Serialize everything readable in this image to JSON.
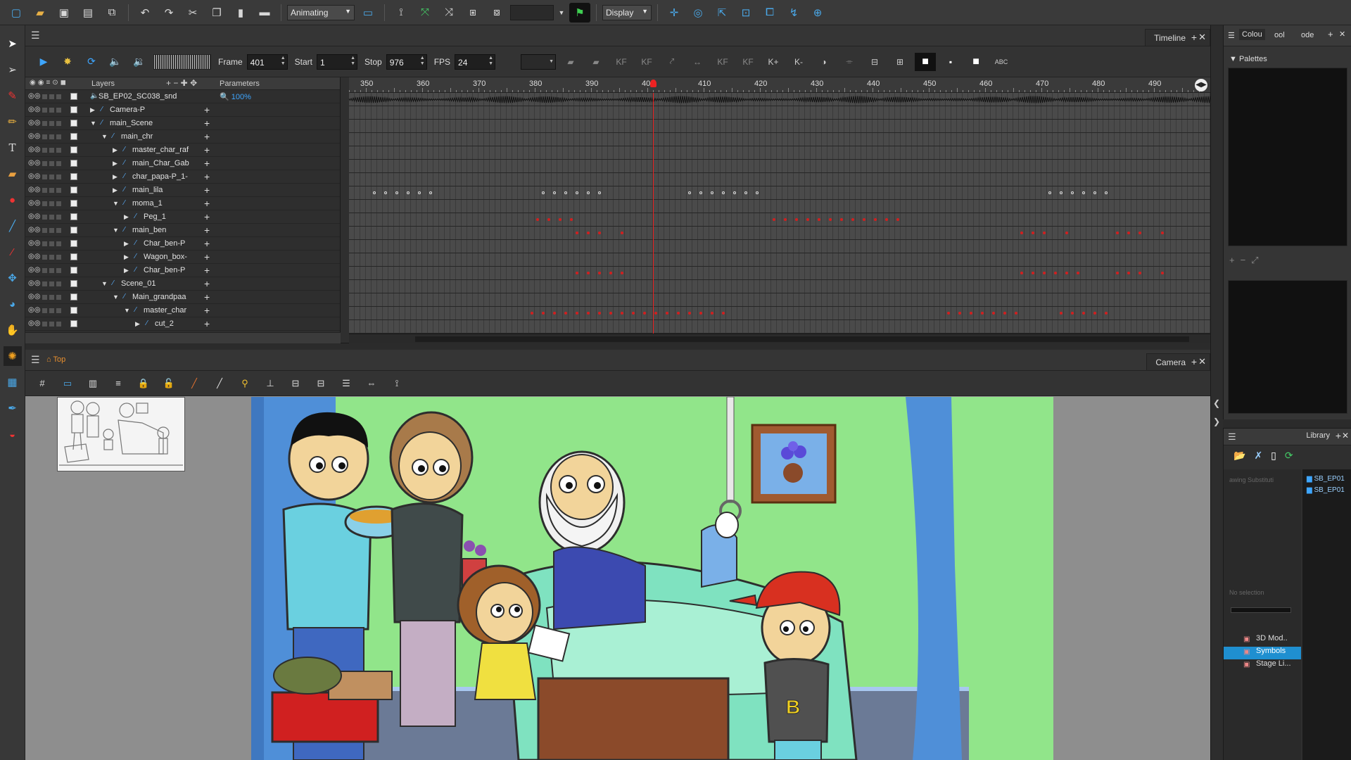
{
  "toolbar": {
    "mode_select": "Animating",
    "display_select": "Display",
    "blank_select": ""
  },
  "timeline": {
    "tab_label": "Timeline",
    "frame_label": "Frame",
    "frame_value": "401",
    "start_label": "Start",
    "start_value": "1",
    "stop_label": "Stop",
    "stop_value": "976",
    "fps_label": "FPS",
    "fps_value": "24",
    "layers_header": "Layers",
    "params_header": "Parameters",
    "ruler_ticks": [
      "350",
      "360",
      "370",
      "380",
      "390",
      "400",
      "410",
      "420",
      "430",
      "440",
      "450",
      "460",
      "470",
      "480",
      "490"
    ],
    "current_frame": 401,
    "layers": [
      {
        "name": "SB_EP02_SC038_snd",
        "indent": 0,
        "type": "sound",
        "expander": "",
        "param": "100%"
      },
      {
        "name": "Camera-P",
        "indent": 1,
        "type": "peg",
        "expander": "closed",
        "param": ""
      },
      {
        "name": "main_Scene",
        "indent": 1,
        "type": "peg",
        "expander": "open",
        "param": ""
      },
      {
        "name": "main_chr",
        "indent": 2,
        "type": "peg",
        "expander": "open",
        "param": ""
      },
      {
        "name": "master_char_raf",
        "indent": 3,
        "type": "peg",
        "expander": "closed",
        "param": ""
      },
      {
        "name": "main_Char_Gab",
        "indent": 3,
        "type": "peg",
        "expander": "closed",
        "param": ""
      },
      {
        "name": "char_papa-P_1-",
        "indent": 3,
        "type": "peg",
        "expander": "closed",
        "param": ""
      },
      {
        "name": "main_lila",
        "indent": 3,
        "type": "peg",
        "expander": "closed",
        "param": ""
      },
      {
        "name": "moma_1",
        "indent": 3,
        "type": "peg",
        "expander": "open",
        "param": ""
      },
      {
        "name": "Peg_1",
        "indent": 4,
        "type": "peg",
        "expander": "closed",
        "param": ""
      },
      {
        "name": "main_ben",
        "indent": 3,
        "type": "peg",
        "expander": "open",
        "param": ""
      },
      {
        "name": "Char_ben-P",
        "indent": 4,
        "type": "peg",
        "expander": "closed",
        "param": ""
      },
      {
        "name": "Wagon_box-",
        "indent": 4,
        "type": "peg",
        "expander": "closed",
        "param": ""
      },
      {
        "name": "Char_ben-P",
        "indent": 4,
        "type": "peg",
        "expander": "closed",
        "param": ""
      },
      {
        "name": "Scene_01",
        "indent": 2,
        "type": "peg",
        "expander": "open",
        "param": ""
      },
      {
        "name": "Main_grandpaa",
        "indent": 3,
        "type": "peg",
        "expander": "open",
        "param": ""
      },
      {
        "name": "master_char",
        "indent": 4,
        "type": "peg",
        "expander": "open",
        "param": ""
      },
      {
        "name": "cut_2",
        "indent": 5,
        "type": "peg",
        "expander": "closed",
        "param": ""
      }
    ],
    "keyframe_rows": [
      {
        "row": 7,
        "style": "hollow",
        "frames": [
          351,
          353,
          355,
          357,
          359,
          361,
          381,
          383,
          385,
          387,
          389,
          391,
          407,
          409,
          411,
          413,
          415,
          417,
          419,
          471,
          473,
          475,
          477,
          479,
          481
        ]
      },
      {
        "row": 9,
        "style": "red",
        "frames": [
          380,
          382,
          384,
          386,
          422,
          424,
          426,
          428,
          430,
          432,
          434,
          436,
          438,
          440,
          442,
          444
        ]
      },
      {
        "row": 10,
        "style": "red",
        "frames": [
          387,
          389,
          391,
          395,
          466,
          468,
          470,
          474,
          483,
          485,
          487,
          491
        ]
      },
      {
        "row": 13,
        "style": "red",
        "frames": [
          387,
          389,
          391,
          393,
          395,
          466,
          468,
          470,
          472,
          474,
          476,
          483,
          485,
          487,
          491
        ]
      },
      {
        "row": 16,
        "style": "red",
        "frames": [
          379,
          381,
          383,
          385,
          387,
          389,
          391,
          393,
          395,
          397,
          399,
          401,
          403,
          405,
          407,
          409,
          411,
          413,
          453,
          455,
          457,
          459,
          461,
          463,
          465,
          473,
          475,
          477,
          479,
          481
        ]
      }
    ]
  },
  "camera": {
    "tab_label": "Camera",
    "crumb": "Top"
  },
  "right_panel": {
    "tab_colour": "Colou",
    "tab_tool": "ool",
    "tab_node": "ode",
    "palettes_label": "Palettes",
    "library_tab": "Library",
    "drawing_substitution": "awing Substituti",
    "no_selection": "No selection",
    "lib_entries": [
      "SB_EP01",
      "SB_EP01"
    ],
    "lib_tree": [
      {
        "label": "3D Mod..",
        "selected": false
      },
      {
        "label": "Symbols",
        "selected": true
      },
      {
        "label": "Stage Li...",
        "selected": false
      }
    ]
  },
  "colors": {
    "accent_blue": "#3ea6ff",
    "keyframe_red": "#d21f1f",
    "playhead": "#ee2222",
    "stage_green": "#91e58a"
  }
}
